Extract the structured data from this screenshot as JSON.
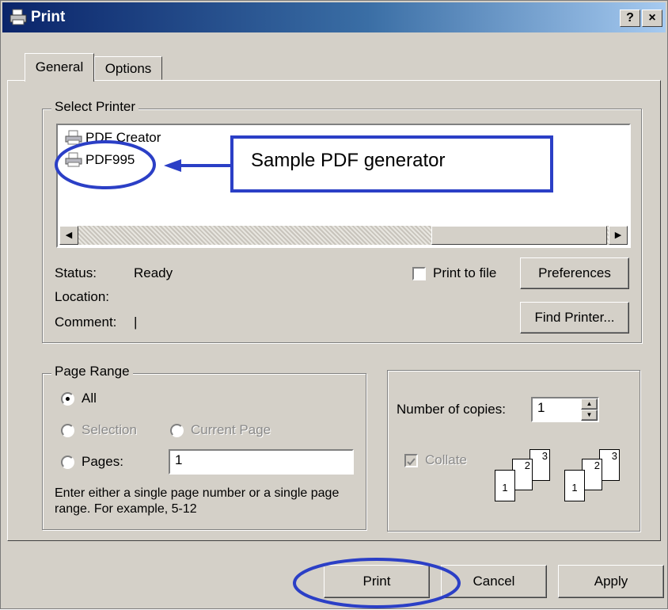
{
  "window": {
    "title": "Print",
    "help_label": "?",
    "close_label": "×"
  },
  "tabs": [
    {
      "label": "General"
    },
    {
      "label": "Options"
    }
  ],
  "select_printer": {
    "group_label": "Select Printer",
    "printers": [
      {
        "name": "PDF Creator"
      },
      {
        "name": "PDF995"
      }
    ],
    "status_label": "Status:",
    "status_value": "Ready",
    "location_label": "Location:",
    "location_value": "",
    "comment_label": "Comment:",
    "comment_value": "|",
    "print_to_file_label": "Print to file",
    "preferences_label": "Preferences",
    "find_printer_label": "Find Printer..."
  },
  "annotation": {
    "callout_text": "Sample PDF generator"
  },
  "page_range": {
    "group_label": "Page Range",
    "all_label": "All",
    "selection_label": "Selection",
    "current_page_label": "Current Page",
    "pages_label": "Pages:",
    "pages_value": "1",
    "hint": "Enter either a single page number or a single page range.  For example, 5-12"
  },
  "copies": {
    "label": "Number of copies:",
    "value": "1",
    "collate_label": "Collate",
    "page_numbers": [
      "1",
      "2",
      "3"
    ]
  },
  "footer": {
    "print_label": "Print",
    "cancel_label": "Cancel",
    "apply_label": "Apply"
  },
  "colors": {
    "annotation_blue": "#2b3fc6",
    "title_bar": "#0a246a",
    "face": "#d4d0c8"
  }
}
